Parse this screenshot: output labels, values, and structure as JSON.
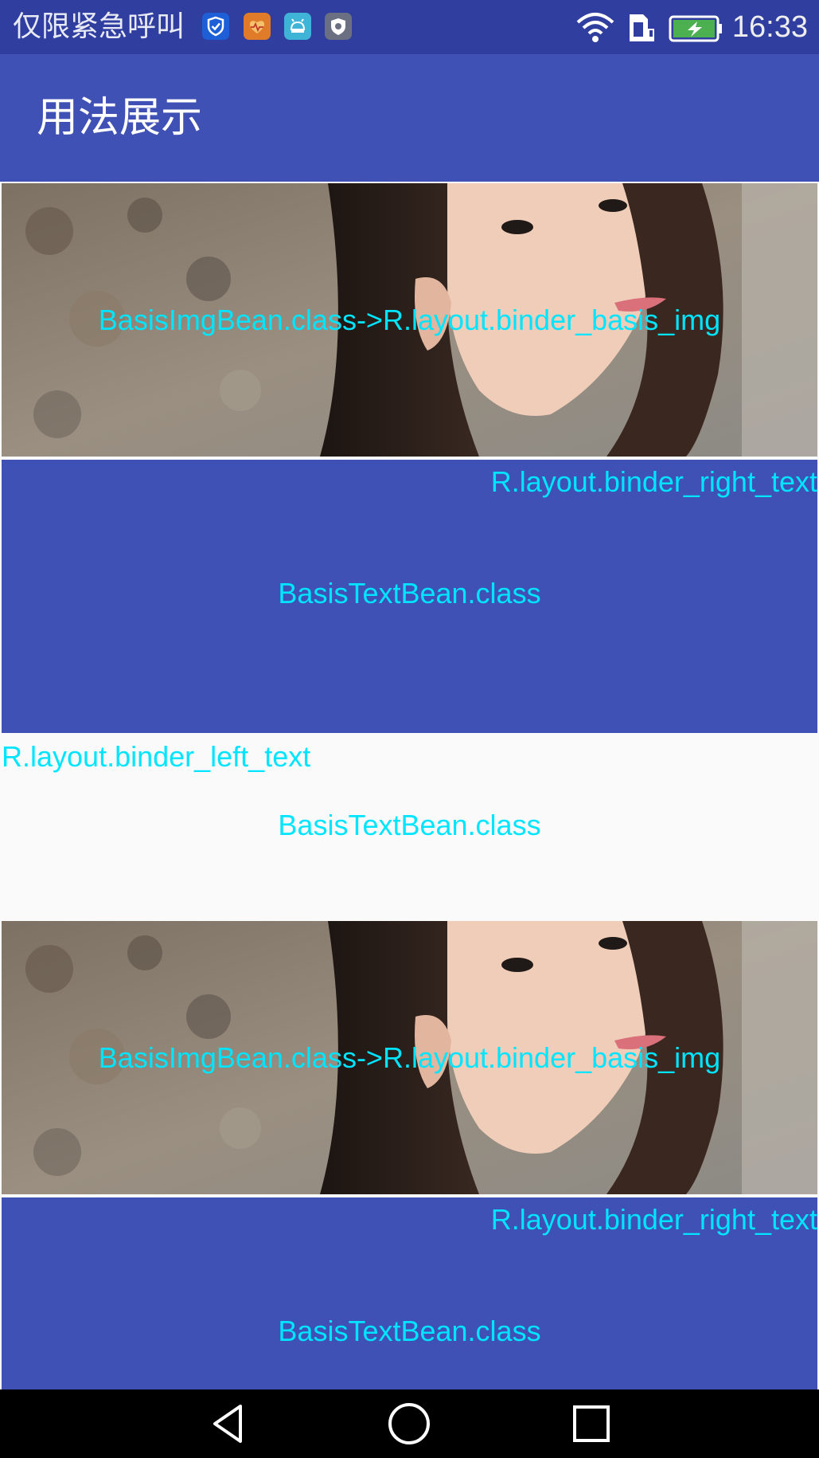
{
  "status_bar": {
    "carrier_text": "仅限紧急呼叫",
    "time": "16:33",
    "icons": [
      "shield-check-icon",
      "heart-app-icon",
      "android-app-icon",
      "security-app-icon",
      "wifi-icon",
      "sim-card-icon",
      "battery-charging-icon"
    ]
  },
  "app_bar": {
    "title": "用法展示"
  },
  "list": {
    "items": [
      {
        "type": "image",
        "caption": "BasisImgBean.class->R.layout.binder_basis_img"
      },
      {
        "type": "right_text",
        "layout_name": "R.layout.binder_right_text",
        "bean": "BasisTextBean.class"
      },
      {
        "type": "left_text",
        "layout_name": "R.layout.binder_left_text",
        "bean": "BasisTextBean.class"
      },
      {
        "type": "image",
        "caption": "BasisImgBean.class->R.layout.binder_basis_img"
      },
      {
        "type": "right_text",
        "layout_name": "R.layout.binder_right_text",
        "bean": "BasisTextBean.class"
      }
    ]
  },
  "nav_bar": {
    "buttons": [
      "back-icon",
      "home-icon",
      "recents-icon"
    ]
  },
  "colors": {
    "primary": "#3f51b5",
    "primary_dark": "#303f9f",
    "accent_text": "#00e5ff",
    "background": "#fafafa"
  }
}
